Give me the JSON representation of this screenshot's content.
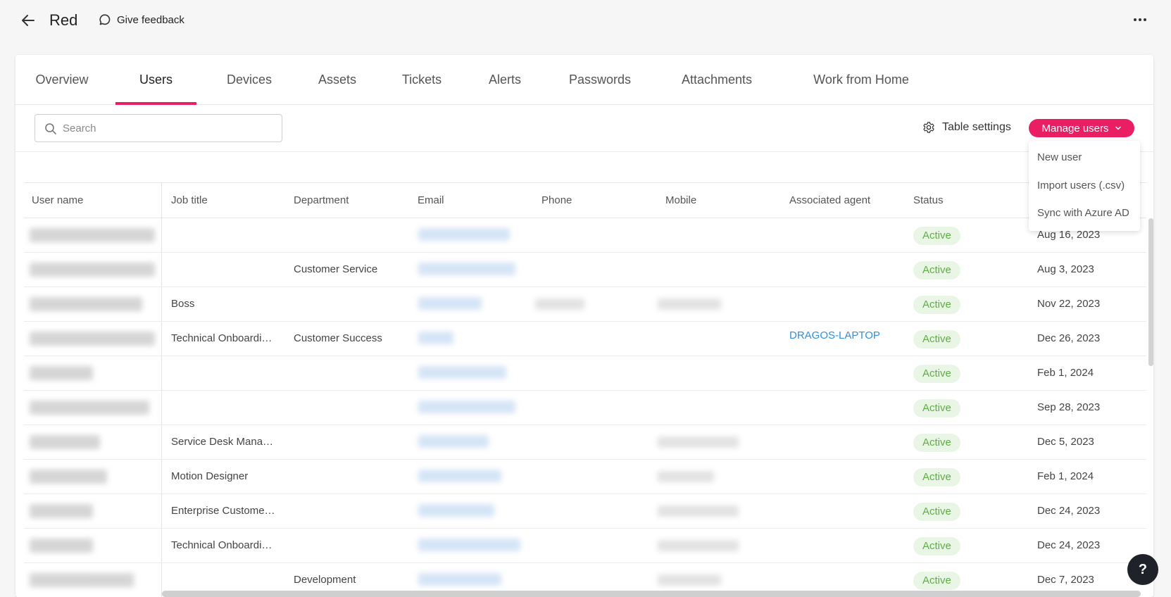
{
  "header": {
    "title": "Red",
    "feedback_label": "Give feedback"
  },
  "tabs": [
    {
      "label": "Overview"
    },
    {
      "label": "Users"
    },
    {
      "label": "Devices"
    },
    {
      "label": "Assets"
    },
    {
      "label": "Tickets"
    },
    {
      "label": "Alerts"
    },
    {
      "label": "Passwords"
    },
    {
      "label": "Attachments"
    },
    {
      "label": "Work from Home"
    }
  ],
  "active_tab": "Users",
  "toolbar": {
    "search_placeholder": "Search",
    "search_value": "",
    "table_settings_label": "Table settings",
    "manage_users_label": "Manage users"
  },
  "manage_menu": {
    "items": [
      {
        "label": "New user"
      },
      {
        "label": "Import users (.csv)"
      },
      {
        "label": "Sync with Azure AD"
      }
    ]
  },
  "table": {
    "columns": [
      "User name",
      "Job title",
      "Department",
      "Email",
      "Phone",
      "Mobile",
      "Associated agent",
      "Status",
      ""
    ],
    "rows": [
      {
        "job_title": "",
        "department": "",
        "agent": "",
        "status": "Active",
        "date": "Aug 16, 2023"
      },
      {
        "job_title": "",
        "department": "Customer Service",
        "agent": "",
        "status": "Active",
        "date": "Aug 3, 2023"
      },
      {
        "job_title": "Boss",
        "department": "",
        "agent": "",
        "status": "Active",
        "date": "Nov 22, 2023"
      },
      {
        "job_title": "Technical Onboardi…",
        "department": "Customer Success",
        "agent": "DRAGOS-LAPTOP",
        "status": "Active",
        "date": "Dec 26, 2023"
      },
      {
        "job_title": "",
        "department": "",
        "agent": "",
        "status": "Active",
        "date": "Feb 1, 2024"
      },
      {
        "job_title": "",
        "department": "",
        "agent": "",
        "status": "Active",
        "date": "Sep 28, 2023"
      },
      {
        "job_title": "Service Desk Mana…",
        "department": "",
        "agent": "",
        "status": "Active",
        "date": "Dec 5, 2023"
      },
      {
        "job_title": "Motion Designer",
        "department": "",
        "agent": "",
        "status": "Active",
        "date": "Feb 1, 2024"
      },
      {
        "job_title": "Enterprise Custome…",
        "department": "",
        "agent": "",
        "status": "Active",
        "date": "Dec 24, 2023"
      },
      {
        "job_title": "Technical Onboardi…",
        "department": "",
        "agent": "",
        "status": "Active",
        "date": "Dec 24, 2023"
      },
      {
        "job_title": "",
        "department": "Development",
        "agent": "",
        "status": "Active",
        "date": "Dec 7, 2023"
      }
    ]
  },
  "help_label": "?",
  "colors": {
    "accent": "#e91e63",
    "status_bg": "#eaf6e5",
    "status_text": "#5cb041",
    "link": "#2f8fe0"
  },
  "icons": [
    "arrow-back-icon",
    "chat-bubble-icon",
    "more-vert-icon",
    "search-icon",
    "gear-icon",
    "chevron-down-icon"
  ]
}
